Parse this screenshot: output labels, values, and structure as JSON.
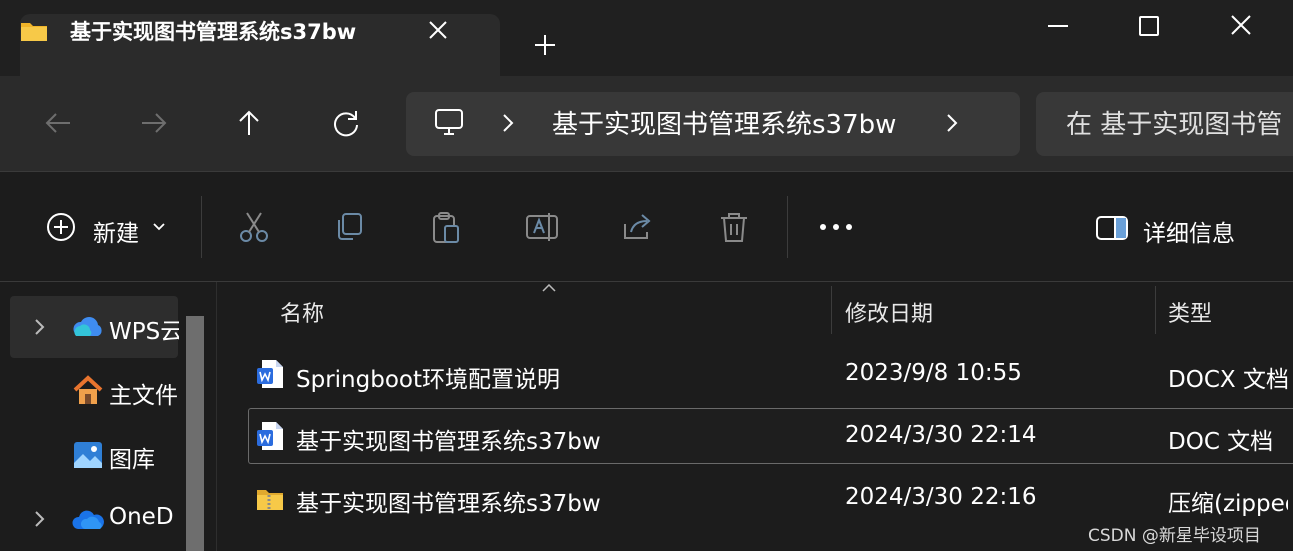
{
  "window": {
    "tab_title": "基于实现图书管理系统s37bw",
    "icons": {
      "folder": "folder-icon",
      "close_tab": "close-icon",
      "new_tab": "plus-icon",
      "minimize": "minimize-icon",
      "maximize": "maximize-icon",
      "close_window": "close-icon"
    }
  },
  "nav": {
    "icons": {
      "back": "arrow-left-icon",
      "forward": "arrow-right-icon",
      "up": "arrow-up-icon",
      "refresh": "refresh-icon"
    },
    "address": {
      "root_icon": "computer-icon",
      "path_text": "基于实现图书管理系统s37bw"
    },
    "search_placeholder": "在 基于实现图书管"
  },
  "toolbar": {
    "new_label": "新建",
    "details_label": "详细信息",
    "icons": [
      "cut-icon",
      "copy-icon",
      "paste-icon",
      "rename-icon",
      "share-icon",
      "delete-icon",
      "more-icon",
      "details-pane-icon"
    ]
  },
  "sidebar": {
    "items": [
      {
        "label": "WPS云",
        "icon": "wps-cloud-icon",
        "expandable": true
      },
      {
        "label": "主文件",
        "icon": "home-icon",
        "expandable": false
      },
      {
        "label": "图库",
        "icon": "gallery-icon",
        "expandable": false
      },
      {
        "label": "OneD",
        "icon": "onedrive-icon",
        "expandable": true
      }
    ]
  },
  "file_list": {
    "columns": [
      "名称",
      "修改日期",
      "类型"
    ],
    "rows": [
      {
        "name": "Springboot环境配置说明",
        "modified": "2023/9/8 10:55",
        "type": "DOCX 文档",
        "icon": "word-doc-icon"
      },
      {
        "name": "基于实现图书管理系统s37bw",
        "modified": "2024/3/30 22:14",
        "type": "DOC 文档",
        "icon": "word-doc-icon"
      },
      {
        "name": "基于实现图书管理系统s37bw",
        "modified": "2024/3/30 22:16",
        "type": "压缩(zipped)",
        "icon": "zip-folder-icon"
      }
    ]
  },
  "watermark": "CSDN @新星毕设项目",
  "colors": {
    "accent": "#0078d4",
    "folder": "#f5c242",
    "word_blue": "#2b6cde"
  }
}
